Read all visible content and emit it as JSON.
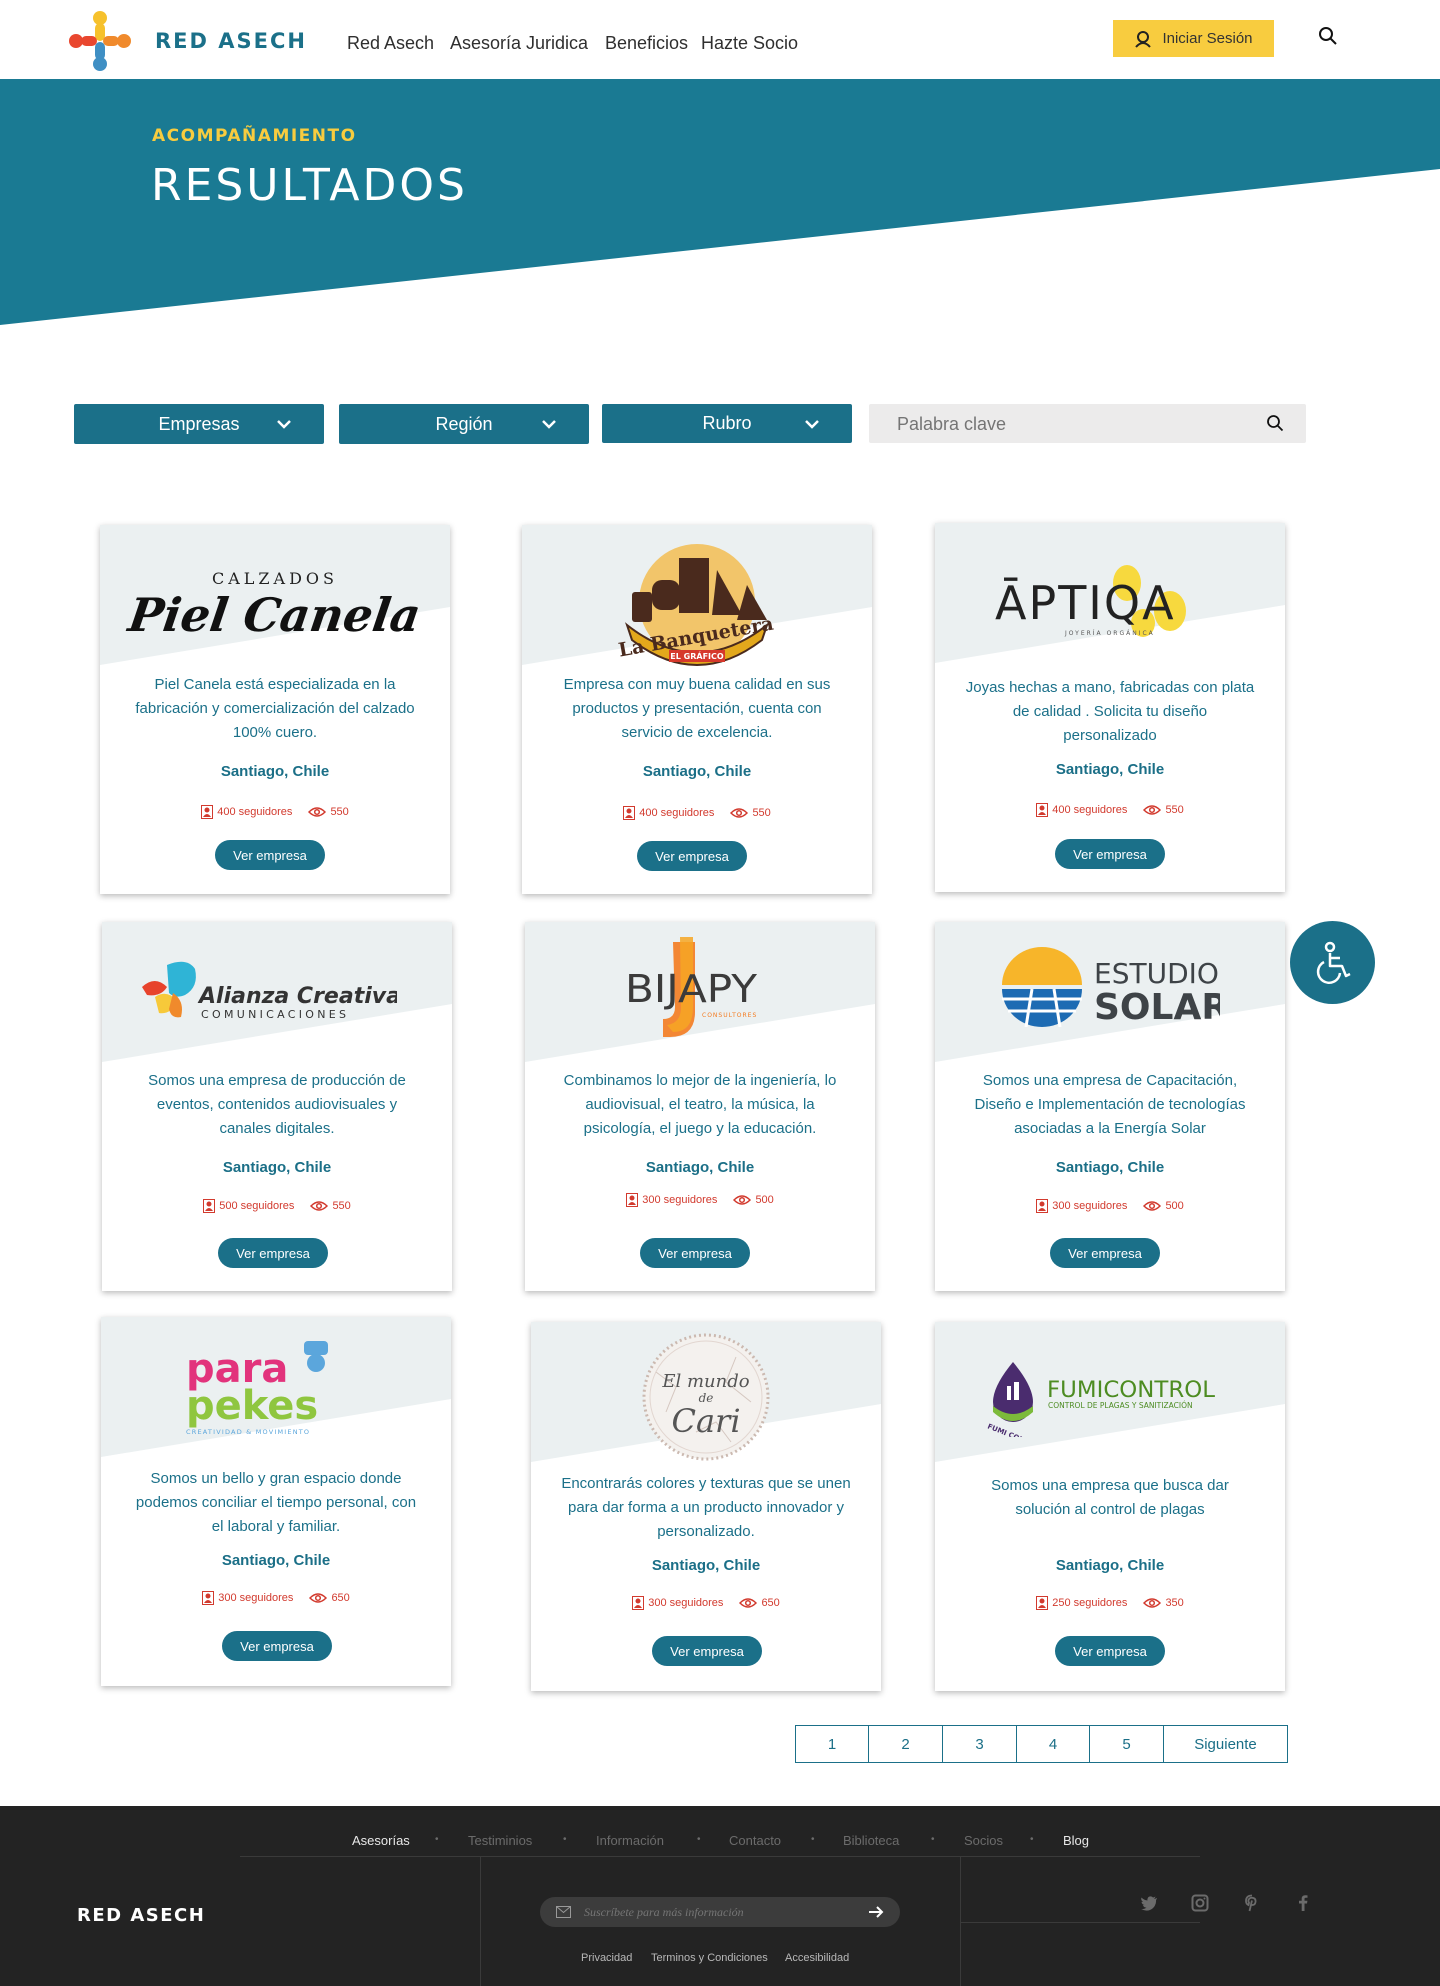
{
  "header": {
    "brand": "RED ASECH",
    "nav": [
      "Red Asech",
      "Asesoría Juridica",
      "Beneficios",
      "Hazte Socio"
    ],
    "login_label": "Iniciar Sesión"
  },
  "hero": {
    "eyebrow": "ACOMPAÑAMIENTO",
    "title": "RESULTADOS"
  },
  "filters": {
    "empresas": "Empresas",
    "region": "Región",
    "rubro": "Rubro",
    "search_placeholder": "Palabra clave"
  },
  "cards": [
    {
      "logo_text_top": "CALZADOS",
      "logo_text": "Piel Canela",
      "desc": "Piel Canela está especializada en la fabricación y comercialización del calzado 100% cuero.",
      "location": "Santiago, Chile",
      "followers": "400 seguidores",
      "views": "550",
      "button": "Ver empresa"
    },
    {
      "logo_text": "La Banquetera",
      "logo_sub": "EL GRÁFICO",
      "desc": "Empresa con muy buena calidad en sus productos y presentación, cuenta con servicio de excelencia.",
      "location": "Santiago, Chile",
      "followers": "400 seguidores",
      "views": "550",
      "button": "Ver empresa"
    },
    {
      "logo_text": "ĀPTIQA",
      "logo_sub": "JOYERÍA ORGÁNICA",
      "desc": "Joyas hechas a mano, fabricadas con plata de calidad . Solicita tu diseño personalizado",
      "location": "Santiago, Chile",
      "followers": "400 seguidores",
      "views": "550",
      "button": "Ver empresa"
    },
    {
      "logo_text": "Alianza Creativa",
      "logo_sub": "COMUNICACIONES",
      "desc": "Somos una empresa de  producción de eventos, contenidos audiovisuales y canales digitales.",
      "location": "Santiago, Chile",
      "followers": "500 seguidores",
      "views": "550",
      "button": "Ver empresa"
    },
    {
      "logo_text": "BIJAPY",
      "logo_sub": "CONSULTORES",
      "desc": "Combinamos lo mejor de la ingeniería, lo audiovisual, el teatro, la música, la psicología, el juego y la educación.",
      "location": "Santiago, Chile",
      "followers": "300 seguidores",
      "views": "500",
      "button": "Ver empresa"
    },
    {
      "logo_text": "ESTUDIO",
      "logo_text2": "SOLAR",
      "desc": "Somos una empresa de Capacitación, Diseño e Implementación de tecnologías asociadas a la Energía Solar",
      "location": "Santiago, Chile",
      "followers": "300 seguidores",
      "views": "500",
      "button": "Ver empresa"
    },
    {
      "logo_text": "para",
      "logo_text2": "pekes",
      "logo_sub": "CREATIVIDAD & MOVIMIENTO",
      "desc": "Somos un bello y gran espacio donde podemos conciliar el tiempo personal, con el laboral y familiar.",
      "location": "Santiago, Chile",
      "followers": "300 seguidores",
      "views": "650",
      "button": "Ver empresa"
    },
    {
      "logo_text": "El mundo",
      "logo_text2": "de",
      "logo_text3": "Cari",
      "desc": "Encontrarás colores y texturas que se unen para dar forma a un producto innovador y personalizado.",
      "location": "Santiago, Chile",
      "followers": "300 seguidores",
      "views": "650",
      "button": "Ver empresa"
    },
    {
      "logo_text": "FUMICONTROL",
      "logo_sub": "CONTROL DE PLAGAS Y SANITIZACIÓN",
      "logo_badge": "FUMI CONTROL",
      "desc": "Somos una empresa que busca dar solución al control de plagas",
      "location": "Santiago, Chile",
      "followers": "250 seguidores",
      "views": "350",
      "button": "Ver empresa"
    }
  ],
  "pagination": [
    "1",
    "2",
    "3",
    "4",
    "5",
    "Siguiente"
  ],
  "footer": {
    "nav": [
      "Asesorías",
      "Testiminios",
      "Información",
      "Contacto",
      "Biblioteca",
      "Socios",
      "Blog"
    ],
    "brand": "RED ASECH",
    "subscribe_placeholder": "Suscríbete para más información",
    "legal": [
      "Privacidad",
      "Terminos y Condiciones",
      "Accesibilidad"
    ]
  },
  "colors": {
    "primary": "#1b7089",
    "accent": "#f8cc3f",
    "footer": "#232323",
    "stat": "#d23a2e"
  }
}
